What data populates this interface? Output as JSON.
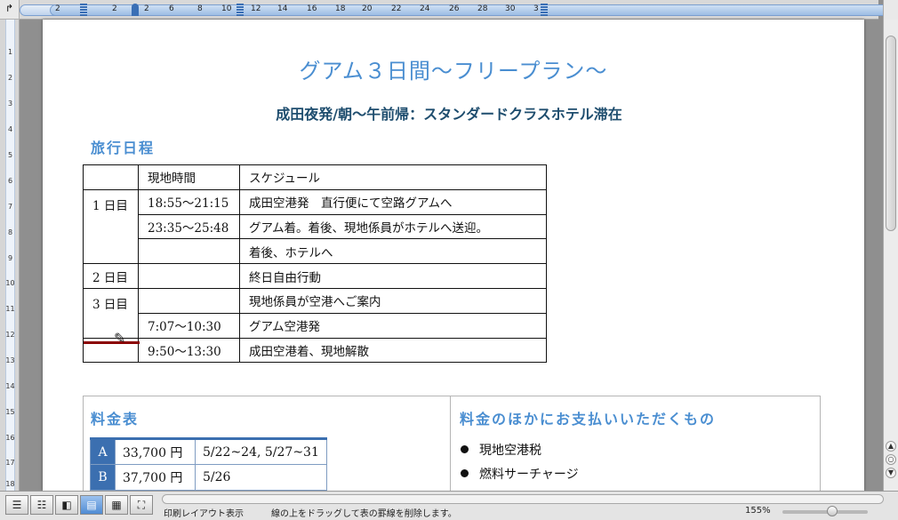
{
  "ruler": {
    "numbers": [
      "2",
      "2",
      "2",
      "4",
      "6",
      "8",
      "10",
      "12",
      "14",
      "16",
      "18",
      "20",
      "22",
      "24",
      "26",
      "28",
      "30",
      "3"
    ],
    "vertical_numbers": [
      "1",
      "2",
      "3",
      "4",
      "5",
      "6",
      "7",
      "8",
      "9",
      "10",
      "11",
      "12",
      "13",
      "14",
      "15",
      "16",
      "17",
      "18"
    ]
  },
  "document": {
    "title": "グアム３日間〜フリープラン〜",
    "subtitle": "成田夜発/朝〜午前帰：スタンダードクラスホテル滞在",
    "itinerary_heading": "旅行日程",
    "itinerary": {
      "header": [
        "",
        "現地時間",
        "スケジュール"
      ],
      "rows": [
        [
          "1 日目",
          "18:55〜21:15",
          "成田空港発　直行便にて空路グアムへ"
        ],
        [
          "",
          "23:35〜25:48",
          "グアム着。着後、現地係員がホテルへ送迎。"
        ],
        [
          "",
          "",
          "着後、ホテルへ"
        ],
        [
          "2 日目",
          "",
          "終日自由行動"
        ],
        [
          "3 日目",
          "",
          "現地係員が空港へご案内"
        ],
        [
          "",
          "7:07〜10:30",
          "グアム空港発"
        ],
        [
          "",
          "9:50〜13:30",
          "成田空港着、現地解散"
        ]
      ]
    },
    "fee_heading": "料金表",
    "fees": [
      {
        "label": "A",
        "price": "33,700 円",
        "dates": "5/22~24, 5/27~31"
      },
      {
        "label": "B",
        "price": "37,700 円",
        "dates": "5/26"
      }
    ],
    "extra_heading": "料金のほかにお支払いいただくもの",
    "extras": [
      "現地空港税",
      "燃料サーチャージ"
    ]
  },
  "statusbar": {
    "view_mode": "印刷レイアウト表示",
    "message": "線の上をドラッグして表の罫線を削除します。",
    "zoom": "155%"
  },
  "colors": {
    "title": "#4a8ed1",
    "subtitle": "#1e4d6e",
    "fee_label_bg": "#3b6fb0",
    "eraser_line": "#8b0000"
  }
}
